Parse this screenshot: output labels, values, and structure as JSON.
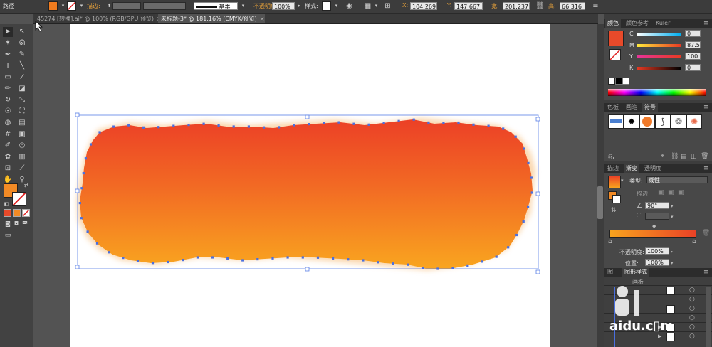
{
  "control_bar": {
    "object_type": "路径",
    "stroke_label": "描边:",
    "stroke_style": "基本",
    "opacity_label": "不透明度",
    "opacity_value": "100%",
    "style_label": "样式:",
    "x_label": "X:",
    "x_value": "104.269",
    "y_label": "Y:",
    "y_value": "147.667",
    "w_label": "宽:",
    "w_value": "201.237",
    "h_label": "高:",
    "h_value": "66.316",
    "fill_color": "#ef7b1e"
  },
  "tabs": [
    {
      "label": "45274 [转换].ai* @ 100% (RGB/GPU 预览)",
      "close": "×",
      "active": false
    },
    {
      "label": "未标题-3* @ 181.16% (CMYK/预览)",
      "close": "×",
      "active": true
    }
  ],
  "tools": {
    "fill_color": "#f28a25",
    "stroke_color": "#ffffff"
  },
  "color_panel": {
    "tabs": [
      "颜色",
      "颜色参考",
      "Kuler"
    ],
    "swatch_color": "#e84a2a",
    "channels": [
      {
        "label": "C",
        "value": "0"
      },
      {
        "label": "M",
        "value": "87.5"
      },
      {
        "label": "Y",
        "value": "100"
      },
      {
        "label": "K",
        "value": "0"
      }
    ]
  },
  "symbols_panel": {
    "tabs": [
      "色板",
      "画笔",
      "符号"
    ],
    "footer_label": "⎌,"
  },
  "gradient_panel": {
    "tabs": [
      "描边",
      "渐变",
      "透明度"
    ],
    "type_label": "类型:",
    "type_value": "线性",
    "stroke_label": "描边",
    "angle_value": "90°",
    "left_color": "#f8a31e",
    "right_color": "#ea4226",
    "opacity_label": "不透明度:",
    "opacity_value": "100%",
    "position_label": "位置:",
    "position_value": "100%"
  },
  "graphic_styles_panel": {
    "tabs": [
      "图",
      "图形样式"
    ],
    "sub_tab": "画板"
  },
  "canvas": {
    "gradient_top": "#ec4026",
    "gradient_bottom": "#f9a51f",
    "anchor_color": "#4a6fe0"
  },
  "watermark": {
    "text": "aidu.c▯m"
  }
}
